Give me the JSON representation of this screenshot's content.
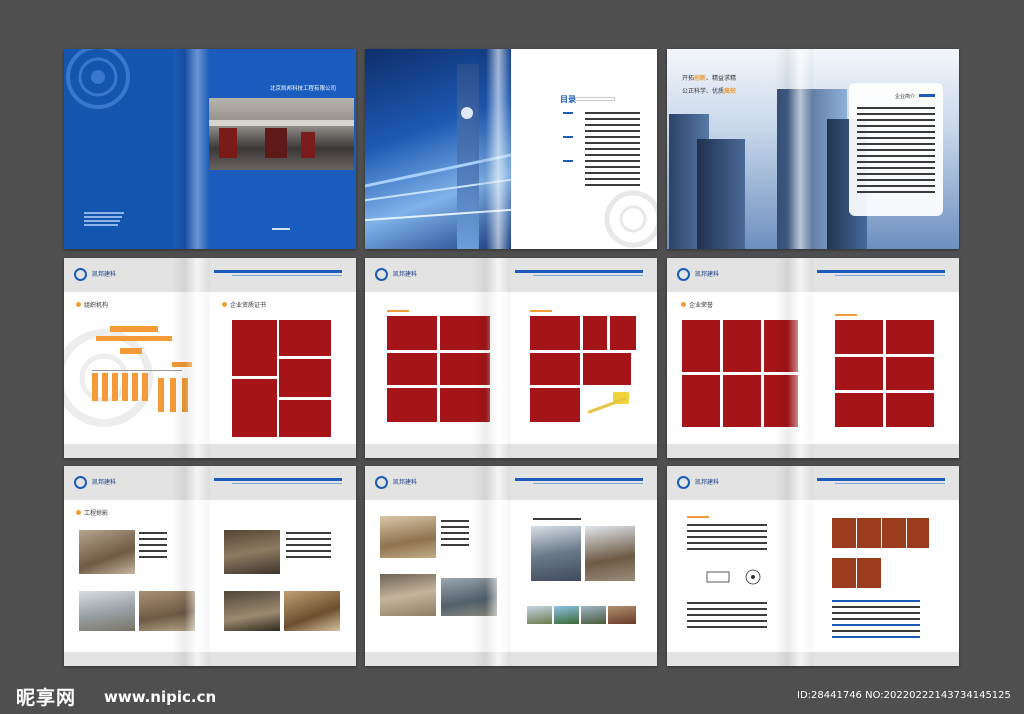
{
  "spread1": {
    "company": "北京凯邦科技工程有限公司"
  },
  "spread2": {
    "toc_title": "目录"
  },
  "spread3": {
    "slogan_line1_a": "开拓",
    "slogan_line1_b": "创新",
    "slogan_line1_c": "、精益求精",
    "slogan_line2_a": "公正科学、优质",
    "slogan_line2_b": "高效",
    "intro_title": "企业简介"
  },
  "header": {
    "name": "凯邦建科"
  },
  "spread4": {
    "left_title": "组织机构",
    "right_title": "企业资质证书"
  },
  "spread6": {
    "left_title": "企业荣誉"
  },
  "spread7": {
    "left_title": "工程掠影"
  },
  "watermark": {
    "logo": "昵享网",
    "url": "www.nipic.cn",
    "id": "ID:28441746 NO:20220222143734145125"
  },
  "colors": {
    "accent_blue": "#1b5cb8",
    "accent_orange": "#f29b38",
    "block_red": "#a51418",
    "block_brown": "#9a3d1f"
  }
}
